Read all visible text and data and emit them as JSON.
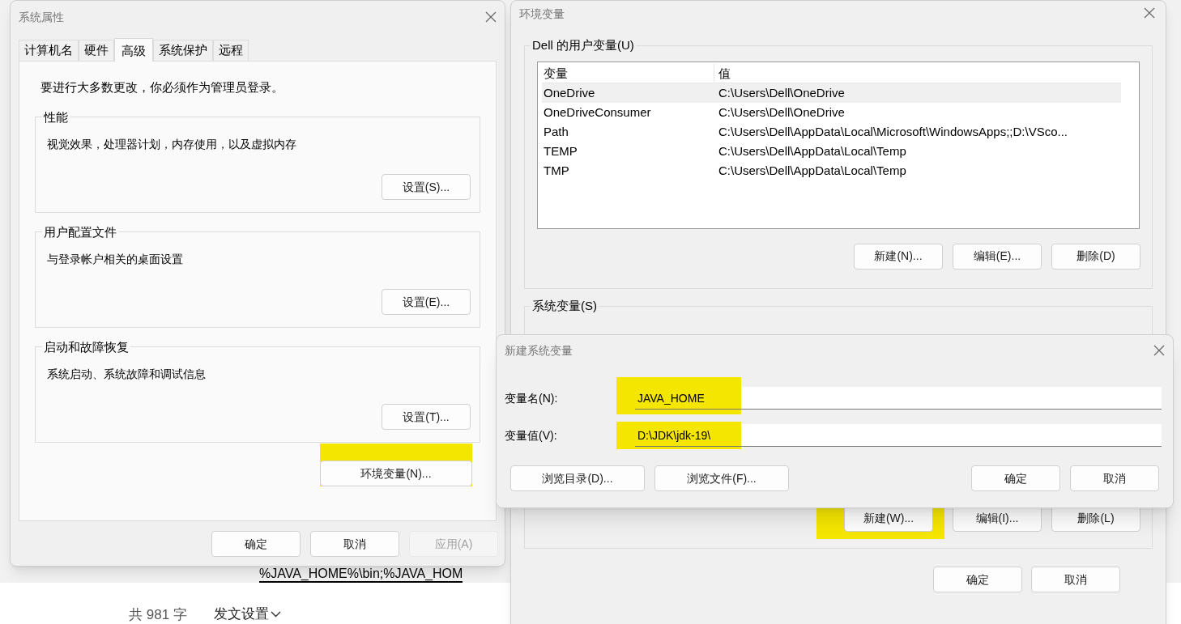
{
  "background": {
    "code_line": "%JAVA_HOME%\\bin;%JAVA_HOM",
    "word_count": "共 981 字",
    "publish_settings": "发文设置"
  },
  "system_properties": {
    "title": "系统属性",
    "tabs": [
      {
        "label": "计算机名",
        "selected": false
      },
      {
        "label": "硬件",
        "selected": false
      },
      {
        "label": "高级",
        "selected": true
      },
      {
        "label": "系统保护",
        "selected": false
      },
      {
        "label": "远程",
        "selected": false
      }
    ],
    "notice": "要进行大多数更改，你必须作为管理员登录。",
    "groups": [
      {
        "title": "性能",
        "description": "视觉效果，处理器计划，内存使用，以及虚拟内存",
        "button": "设置(S)..."
      },
      {
        "title": "用户配置文件",
        "description": "与登录帐户相关的桌面设置",
        "button": "设置(E)..."
      },
      {
        "title": "启动和故障恢复",
        "description": "系统启动、系统故障和调试信息",
        "button": "设置(T)..."
      }
    ],
    "env_button": {
      "label": "环境变量(N)...",
      "highlighted": true
    },
    "buttons": [
      {
        "label": "确定",
        "disabled": false
      },
      {
        "label": "取消",
        "disabled": false
      },
      {
        "label": "应用(A)",
        "disabled": true
      }
    ]
  },
  "env_vars": {
    "title": "环境变量",
    "user_group": {
      "title": "Dell 的用户变量(U)",
      "columns": [
        "变量",
        "值"
      ],
      "rows": [
        {
          "name": "OneDrive",
          "value": "C:\\Users\\Dell\\OneDrive",
          "selected": true
        },
        {
          "name": "OneDriveConsumer",
          "value": "C:\\Users\\Dell\\OneDrive",
          "selected": false
        },
        {
          "name": "Path",
          "value": "C:\\Users\\Dell\\AppData\\Local\\Microsoft\\WindowsApps;;D:\\VSco...",
          "selected": false
        },
        {
          "name": "TEMP",
          "value": "C:\\Users\\Dell\\AppData\\Local\\Temp",
          "selected": false
        },
        {
          "name": "TMP",
          "value": "C:\\Users\\Dell\\AppData\\Local\\Temp",
          "selected": false
        }
      ],
      "buttons": [
        {
          "label": "新建(N)...",
          "highlighted": false
        },
        {
          "label": "编辑(E)...",
          "highlighted": false
        },
        {
          "label": "删除(D)",
          "highlighted": false
        }
      ]
    },
    "system_group": {
      "title": "系统变量(S)",
      "buttons": [
        {
          "label": "新建(W)...",
          "highlighted": true
        },
        {
          "label": "编辑(I)...",
          "highlighted": false
        },
        {
          "label": "删除(L)",
          "highlighted": false
        }
      ]
    },
    "buttons": [
      "确定",
      "取消"
    ]
  },
  "new_var_dialog": {
    "title": "新建系统变量",
    "fields": [
      {
        "label": "变量名(N):",
        "value": "JAVA_HOME",
        "highlighted": true
      },
      {
        "label": "变量值(V):",
        "value": "D:\\JDK\\jdk-19\\",
        "highlighted": true
      }
    ],
    "left_buttons": [
      "浏览目录(D)...",
      "浏览文件(F)..."
    ],
    "right_buttons": [
      "确定",
      "取消"
    ]
  }
}
